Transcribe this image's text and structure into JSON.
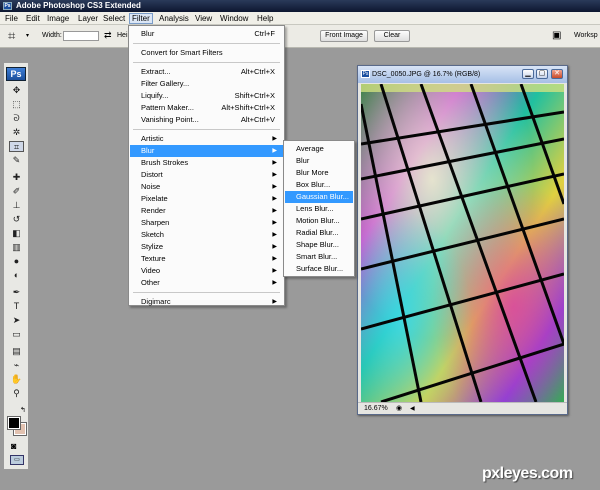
{
  "app": {
    "title": "Adobe Photoshop CS3 Extended",
    "icon": "ps-icon"
  },
  "menubar": [
    {
      "label": "File"
    },
    {
      "label": "Edit"
    },
    {
      "label": "Image"
    },
    {
      "label": "Layer"
    },
    {
      "label": "Select"
    },
    {
      "label": "Filter"
    },
    {
      "label": "Analysis"
    },
    {
      "label": "View"
    },
    {
      "label": "Window"
    },
    {
      "label": "Help"
    }
  ],
  "options_bar": {
    "tool_icon": "crop-icon",
    "width_label": "Width:",
    "height_label_partial": "Hei",
    "front_image": "Front Image",
    "clear": "Clear",
    "workspace": "Worksp"
  },
  "toolbox": {
    "logo": "Ps",
    "tools": [
      {
        "name": "move-tool-icon",
        "glyph": "✥"
      },
      {
        "name": "marquee-tool-icon",
        "glyph": "⬚"
      },
      {
        "name": "lasso-tool-icon",
        "glyph": "ᘐ"
      },
      {
        "name": "magic-wand-tool-icon",
        "glyph": "✲"
      },
      {
        "name": "crop-tool-icon",
        "glyph": "⌗"
      },
      {
        "name": "slice-tool-icon",
        "glyph": "✎"
      },
      {
        "name": "healing-brush-tool-icon",
        "glyph": "✚"
      },
      {
        "name": "brush-tool-icon",
        "glyph": "✐"
      },
      {
        "name": "clone-stamp-tool-icon",
        "glyph": "⊥"
      },
      {
        "name": "history-brush-tool-icon",
        "glyph": "↺"
      },
      {
        "name": "eraser-tool-icon",
        "glyph": "◧"
      },
      {
        "name": "gradient-tool-icon",
        "glyph": "▥"
      },
      {
        "name": "blur-tool-icon",
        "glyph": "●"
      },
      {
        "name": "dodge-tool-icon",
        "glyph": "◐"
      },
      {
        "name": "pen-tool-icon",
        "glyph": "✒"
      },
      {
        "name": "type-tool-icon",
        "glyph": "T"
      },
      {
        "name": "path-selection-tool-icon",
        "glyph": "➤"
      },
      {
        "name": "shape-tool-icon",
        "glyph": "▭"
      },
      {
        "name": "notes-tool-icon",
        "glyph": "▤"
      },
      {
        "name": "eyedropper-tool-icon",
        "glyph": "⌁"
      },
      {
        "name": "hand-tool-icon",
        "glyph": "✋"
      },
      {
        "name": "zoom-tool-icon",
        "glyph": "⚲"
      }
    ],
    "fg_color": "#000000",
    "bg_color": "#e2c2b0"
  },
  "document": {
    "title": "DSC_0050.JPG @ 16.7% (RGB/8)",
    "zoom": "16.67%"
  },
  "filter_menu": {
    "items": [
      {
        "label": "Blur",
        "shortcut": "Ctrl+F"
      },
      {
        "sep": true
      },
      {
        "label": "Convert for Smart Filters"
      },
      {
        "sep": true
      },
      {
        "label": "Extract...",
        "shortcut": "Alt+Ctrl+X"
      },
      {
        "label": "Filter Gallery..."
      },
      {
        "label": "Liquify...",
        "shortcut": "Shift+Ctrl+X"
      },
      {
        "label": "Pattern Maker...",
        "shortcut": "Alt+Shift+Ctrl+X"
      },
      {
        "label": "Vanishing Point...",
        "shortcut": "Alt+Ctrl+V"
      },
      {
        "sep": true
      },
      {
        "label": "Artistic",
        "submenu": true
      },
      {
        "label": "Blur",
        "submenu": true,
        "highlighted": true
      },
      {
        "label": "Brush Strokes",
        "submenu": true
      },
      {
        "label": "Distort",
        "submenu": true
      },
      {
        "label": "Noise",
        "submenu": true
      },
      {
        "label": "Pixelate",
        "submenu": true
      },
      {
        "label": "Render",
        "submenu": true
      },
      {
        "label": "Sharpen",
        "submenu": true
      },
      {
        "label": "Sketch",
        "submenu": true
      },
      {
        "label": "Stylize",
        "submenu": true
      },
      {
        "label": "Texture",
        "submenu": true
      },
      {
        "label": "Video",
        "submenu": true
      },
      {
        "label": "Other",
        "submenu": true
      },
      {
        "sep": true
      },
      {
        "label": "Digimarc",
        "submenu": true
      }
    ]
  },
  "blur_submenu": {
    "items": [
      {
        "label": "Average"
      },
      {
        "label": "Blur"
      },
      {
        "label": "Blur More"
      },
      {
        "label": "Box Blur..."
      },
      {
        "label": "Gaussian Blur...",
        "highlighted": true
      },
      {
        "label": "Lens Blur..."
      },
      {
        "label": "Motion Blur..."
      },
      {
        "label": "Radial Blur..."
      },
      {
        "label": "Shape Blur..."
      },
      {
        "label": "Smart Blur..."
      },
      {
        "label": "Surface Blur..."
      }
    ]
  },
  "watermark": "pxleyes.com",
  "colors": {
    "highlight": "#3399ff",
    "workspace_bg": "#9a9a9a",
    "menubar_bg": "#f0efe8"
  }
}
